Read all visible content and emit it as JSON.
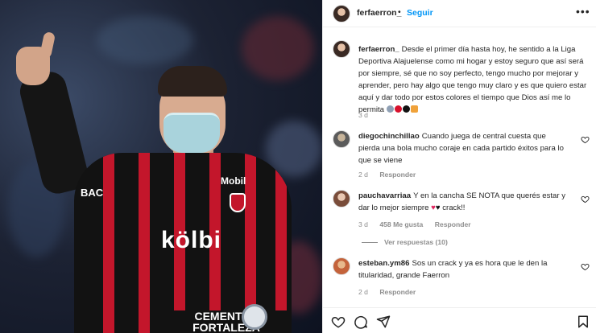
{
  "post": {
    "username": "ferfaerron_",
    "separator": "•",
    "follow_label": "Seguir",
    "more_label": "•••",
    "caption_text": "Desde el primer día hasta hoy, he sentido a la Liga Deportiva Alajuelense como mi hogar y estoy seguro que así será por siempre, sé que no soy perfecto, tengo mucho por mejorar y aprender, pero hay algo que tengo muy claro y es que quiero estar aquí y dar todo por estos colores el tiempo que Dios así me lo permita",
    "caption_time": "3 d",
    "photo_sponsors": {
      "kolbi": "kölbi",
      "bac": "BAC",
      "mobil": "Mobil",
      "cementos": "CEMENTOS FORTALEZA"
    }
  },
  "comments": [
    {
      "username": "diegochinchillao",
      "text": "Cuando juega de central cuesta que pierda una bola mucho coraje en cada partido éxitos para lo que se viene",
      "time": "2 d",
      "reply_label": "Responder"
    },
    {
      "username": "pauchavarriaa",
      "text_before": "Y en la cancha SE NOTA que querés estar y dar lo mejor siempre",
      "heart_red": "♥",
      "heart_black": "♥",
      "text_after": "crack!!",
      "time": "3 d",
      "likes": "458 Me gusta",
      "reply_label": "Responder",
      "view_replies": "Ver respuestas (10)"
    },
    {
      "username": "esteban.ym86",
      "text": "Sos un crack y ya es hora que le den la titularidad, grande Faerron",
      "time": "2 d",
      "reply_label": "Responder"
    }
  ],
  "icons": {
    "like": "heart-icon",
    "comment": "comment-icon",
    "share": "share-icon",
    "save": "bookmark-icon"
  }
}
